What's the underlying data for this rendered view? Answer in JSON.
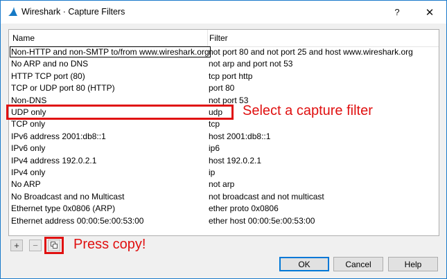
{
  "window": {
    "title": "Wireshark · Capture Filters",
    "help_glyph": "?",
    "close_glyph": "✕"
  },
  "table": {
    "columns": [
      "Name",
      "Filter"
    ],
    "rows": [
      {
        "name": "Non-HTTP and non-SMTP to/from www.wireshark.org",
        "filter": "not port 80 and not port 25 and host www.wireshark.org"
      },
      {
        "name": "No ARP and no DNS",
        "filter": "not arp and port not 53"
      },
      {
        "name": "HTTP TCP port (80)",
        "filter": "tcp port http"
      },
      {
        "name": "TCP or UDP port 80 (HTTP)",
        "filter": "port 80"
      },
      {
        "name": "Non-DNS",
        "filter": "not port 53"
      },
      {
        "name": "UDP only",
        "filter": "udp"
      },
      {
        "name": "TCP only",
        "filter": "tcp"
      },
      {
        "name": "IPv6 address 2001:db8::1",
        "filter": "host 2001:db8::1"
      },
      {
        "name": "IPv6 only",
        "filter": "ip6"
      },
      {
        "name": "IPv4 address 192.0.2.1",
        "filter": "host 192.0.2.1"
      },
      {
        "name": "IPv4 only",
        "filter": "ip"
      },
      {
        "name": "No ARP",
        "filter": "not arp"
      },
      {
        "name": "No Broadcast and no Multicast",
        "filter": "not broadcast and not multicast"
      },
      {
        "name": "Ethernet type 0x0806 (ARP)",
        "filter": "ether proto 0x0806"
      },
      {
        "name": "Ethernet address 00:00:5e:00:53:00",
        "filter": "ether host 00:00:5e:00:53:00"
      }
    ]
  },
  "annotations": {
    "select_text": "Select a capture filter",
    "copy_text": "Press copy!"
  },
  "toolbar": {
    "add_label": "+",
    "remove_label": "−"
  },
  "buttons": {
    "ok": "OK",
    "cancel": "Cancel",
    "help": "Help"
  },
  "colors": {
    "annotation": "#e01010",
    "window_border": "#1979ca"
  }
}
